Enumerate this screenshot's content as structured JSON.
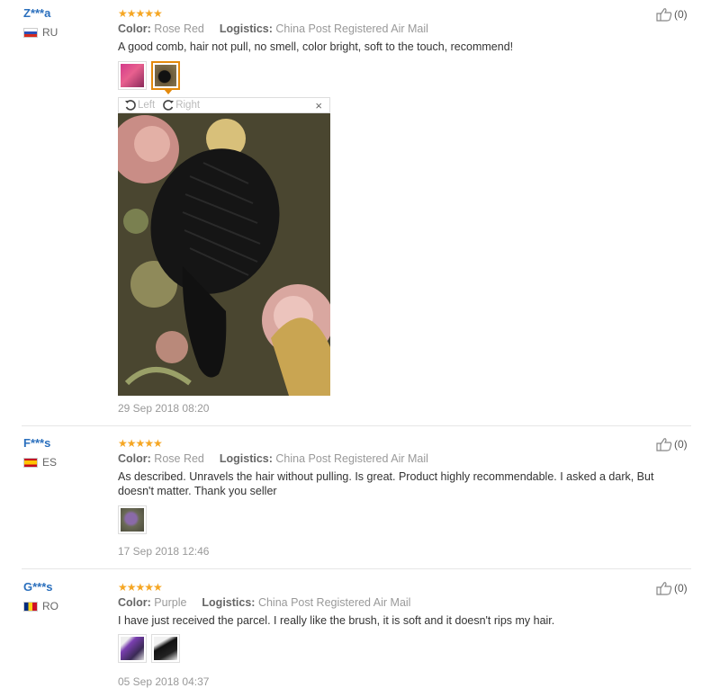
{
  "reviews": [
    {
      "user": "Z***a",
      "country": "RU",
      "stars": "★★★★★",
      "color_label": "Color:",
      "color_value": "Rose Red",
      "logistics_label": "Logistics:",
      "logistics_value": "China Post Registered Air Mail",
      "text": "A good comb, hair not pull, no smell, color bright, soft to the touch, recommend!",
      "date": "29 Sep 2018 08:20",
      "likes": "(0)"
    },
    {
      "user": "F***s",
      "country": "ES",
      "stars": "★★★★★",
      "color_label": "Color:",
      "color_value": "Rose Red",
      "logistics_label": "Logistics:",
      "logistics_value": "China Post Registered Air Mail",
      "text": "As described. Unravels the hair without pulling. Is great. Product highly recommendable. I asked a dark, But doesn't matter. Thank you seller",
      "date": "17 Sep 2018 12:46",
      "likes": "(0)"
    },
    {
      "user": "G***s",
      "country": "RO",
      "stars": "★★★★★",
      "color_label": "Color:",
      "color_value": "Purple",
      "logistics_label": "Logistics:",
      "logistics_value": "China Post Registered Air Mail",
      "text": "I have just received the parcel. I really like the brush, it is soft and it doesn't rips my hair.",
      "date": "05 Sep 2018 04:37",
      "likes": "(0)"
    }
  ],
  "viewer": {
    "rotate_left": "Left",
    "rotate_right": "Right",
    "close": "×"
  },
  "icons": {
    "like": "thumbs-up-icon",
    "rotate_left": "rotate-left-icon",
    "rotate_right": "rotate-right-icon",
    "close": "close-icon"
  },
  "colors": {
    "username": "#2a6fbd",
    "stars": "#f5a623",
    "selected_thumb_border": "#e48a0c"
  }
}
